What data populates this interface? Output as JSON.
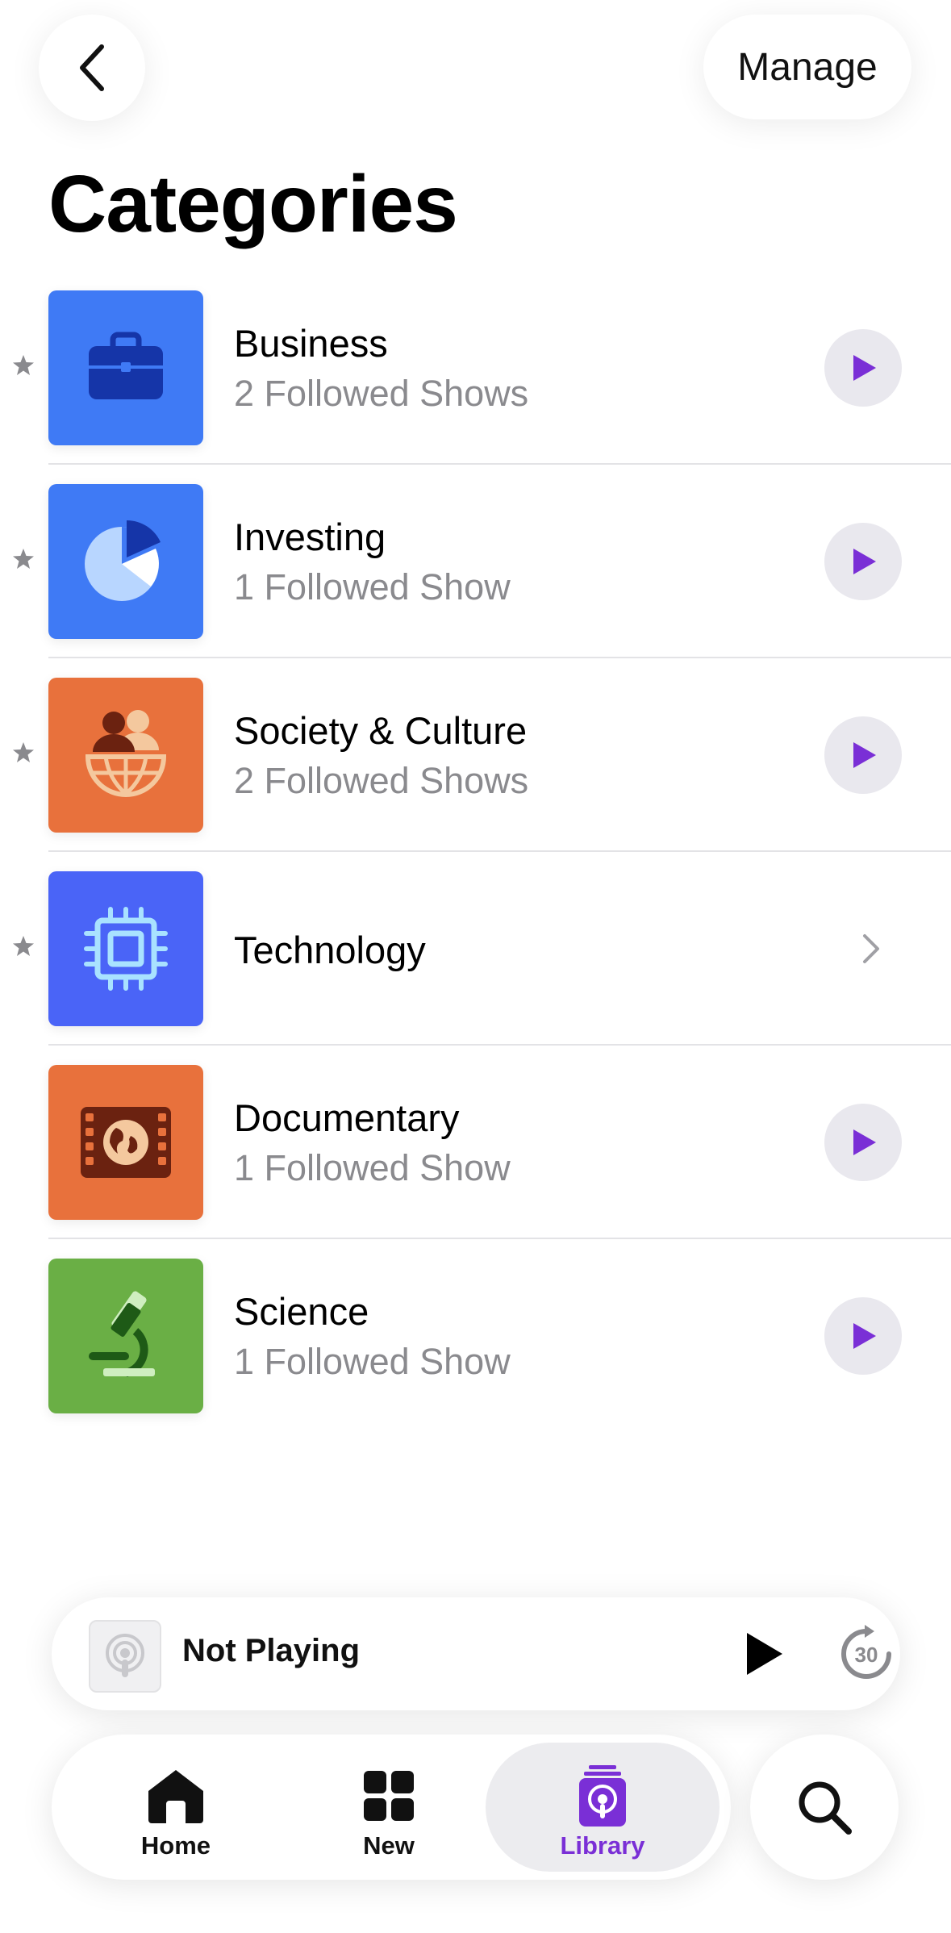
{
  "header": {
    "back_icon": "chevron-left-icon",
    "manage_label": "Manage",
    "title": "Categories"
  },
  "categories": [
    {
      "name": "Business",
      "subtitle": "2 Followed Shows",
      "starred": true,
      "tile_color": "#3f7af5",
      "icon": "briefcase-icon",
      "action": "play"
    },
    {
      "name": "Investing",
      "subtitle": "1 Followed Show",
      "starred": true,
      "tile_color": "#3f7af5",
      "icon": "pie-chart-icon",
      "action": "play"
    },
    {
      "name": "Society & Culture",
      "subtitle": "2 Followed Shows",
      "starred": true,
      "tile_color": "#e8713c",
      "icon": "people-globe-icon",
      "action": "play"
    },
    {
      "name": "Technology",
      "subtitle": "",
      "starred": true,
      "tile_color": "#4a64f7",
      "icon": "chip-icon",
      "action": "chevron"
    },
    {
      "name": "Documentary",
      "subtitle": "1 Followed Show",
      "starred": false,
      "tile_color": "#e8713c",
      "icon": "film-globe-icon",
      "action": "play"
    },
    {
      "name": "Science",
      "subtitle": "1 Followed Show",
      "starred": false,
      "tile_color": "#6aaf45",
      "icon": "microscope-icon",
      "action": "play"
    }
  ],
  "mini_player": {
    "status": "Not Playing",
    "play_icon": "play-icon",
    "skip_label": "30",
    "skip_icon": "skip-forward-30-icon"
  },
  "tab_bar": {
    "tabs": [
      {
        "label": "Home",
        "icon": "home-icon",
        "selected": false
      },
      {
        "label": "New",
        "icon": "grid-icon",
        "selected": false
      },
      {
        "label": "Library",
        "icon": "podcast-library-icon",
        "selected": true
      }
    ],
    "search_icon": "search-icon"
  },
  "colors": {
    "accent": "#7a2fd6",
    "subtitle_gray": "#8a8a8e",
    "play_button_bg": "#e9e8ee"
  }
}
